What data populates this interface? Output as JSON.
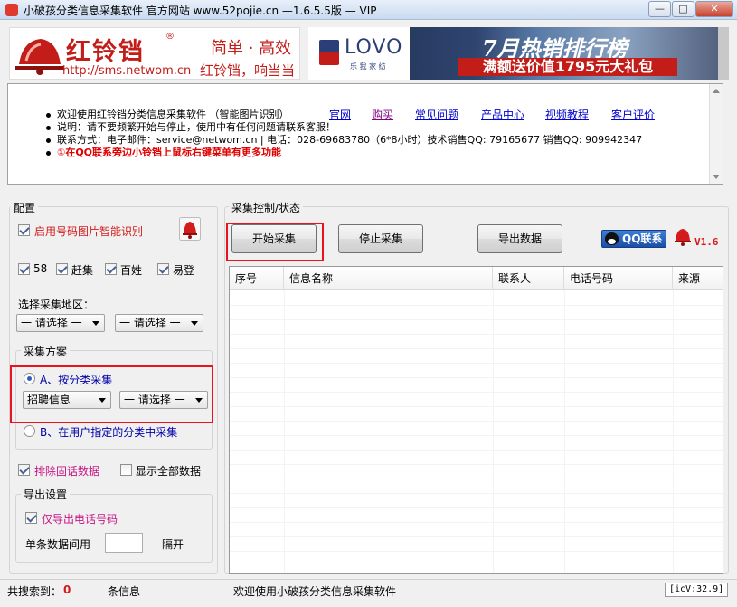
{
  "window": {
    "title": "小破孩分类信息采集软件 官方网站 www.52pojie.cn —1.6.5.5版 — VIP",
    "minimize": "—",
    "maximize": "□",
    "close": "✕"
  },
  "banner": {
    "logo_name": "红铃铛",
    "logo_reg": "®",
    "logo_url": "http://sms.netwom.cn",
    "slogan_1": "简单 · 高效",
    "slogan_2": "红铃铛，响当当",
    "ad_brand": "LOVO",
    "ad_sub": "乐 我 家 纺",
    "ad_headline": "7月热销排行榜",
    "ad_offer": "满额送价值1795元大礼包"
  },
  "info": {
    "line1": "欢迎使用红铃铛分类信息采集软件  （智能图片识别）",
    "line2": "说明：请不要频繁开始与停止，使用中有任何问题请联系客服！",
    "line3": "联系方式：电子邮件：service@netwom.cn | 电话：028-69683780（6*8小时）技术销售QQ: 79165677 销售QQ: 909942347",
    "line4": "①在QQ联系旁边小铃铛上鼠标右键菜单有更多功能",
    "links": [
      "官网",
      "购买",
      "常见问题",
      "产品中心",
      "视频教程",
      "客户评价"
    ]
  },
  "config": {
    "title": "配置",
    "smart_recognition": "启用号码图片智能识别",
    "sources": [
      "58",
      "赶集",
      "百姓",
      "易登"
    ],
    "region_label": "选择采集地区：",
    "region_1": "一 请选择 一",
    "region_2": "一 请选择 一",
    "scheme_title": "采集方案",
    "scheme_a": "A、按分类采集",
    "scheme_a_category": "招聘信息",
    "scheme_a_sub": "一 请选择 一",
    "scheme_b": "B、在用户指定的分类中采集",
    "exclude_landline": "排除固话数据",
    "show_all": "显示全部数据",
    "export_title": "导出设置",
    "export_phone_only": "仅导出电话号码",
    "interval_label": "单条数据间用",
    "interval_value": "",
    "interval_suffix": "隔开"
  },
  "control": {
    "title": "采集控制/状态",
    "start": "开始采集",
    "stop": "停止采集",
    "export": "导出数据",
    "qq_contact": "QQ联系",
    "version": "V1.6"
  },
  "table": {
    "columns": [
      "序号",
      "信息名称",
      "联系人",
      "电话号码",
      "来源"
    ],
    "rows": []
  },
  "status": {
    "found_label": "共搜索到：",
    "found_count": "0",
    "found_unit": "条信息",
    "message": "欢迎使用小破孩分类信息采集软件",
    "version": "[icV:32.9]"
  }
}
